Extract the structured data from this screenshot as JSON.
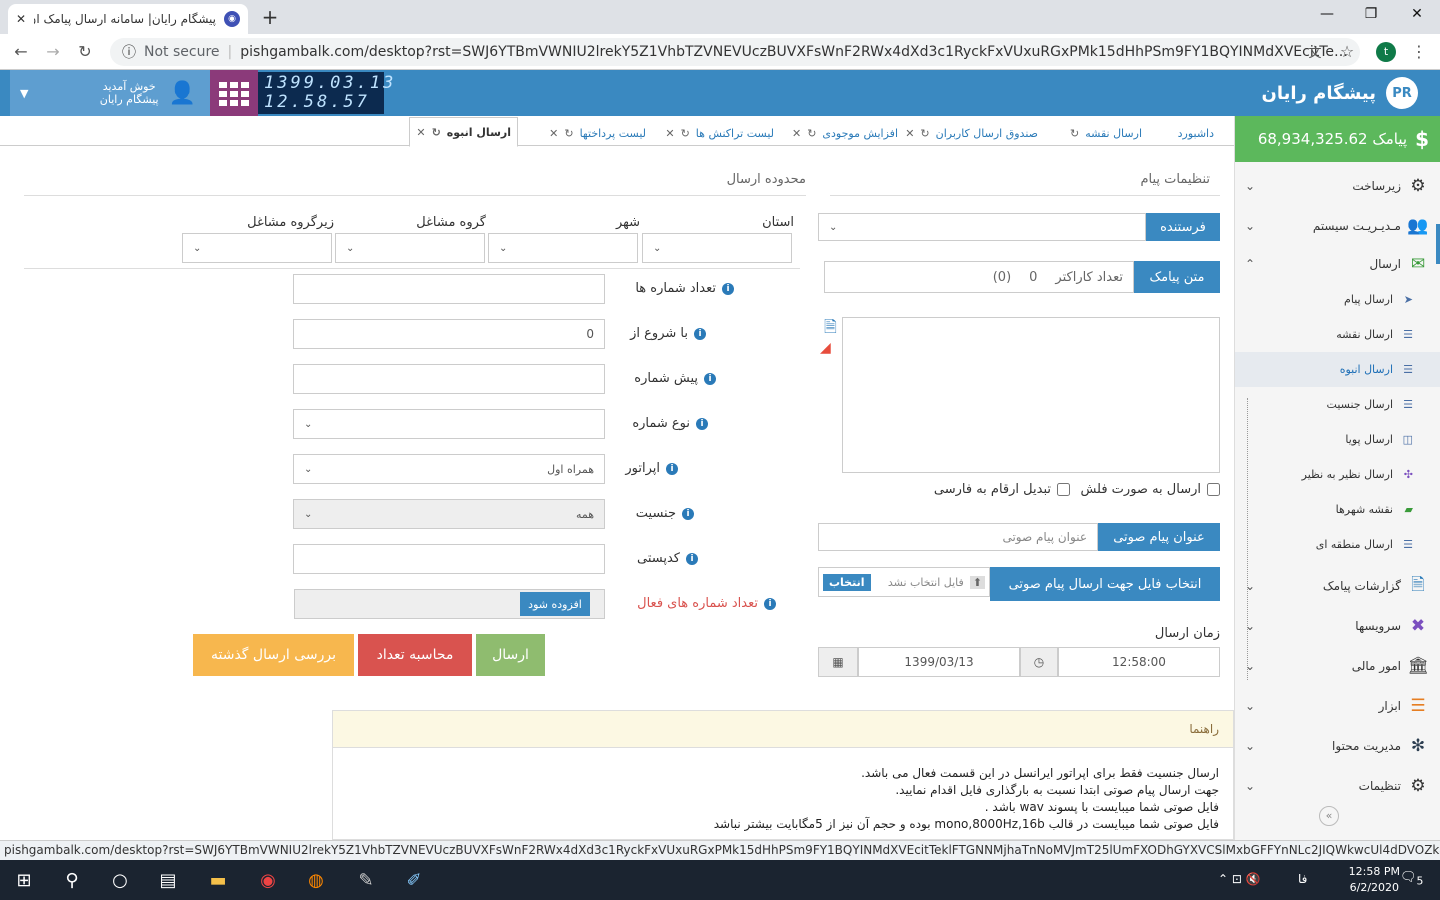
{
  "browser": {
    "tab_title": "پیشگام رایان| سامانه ارسال پیامک ان",
    "new_tab": "+",
    "security": "Not secure",
    "url": "pishgambalk.com/desktop?rst=SWJ6YTBmVWNIU2lrekY5Z1VhbTZVNEVUczBUVXFsWnF2RWx4dXd3c1RyckFxVUxuRGxPMk15dHhPSm9FY1BQYINMdXVEcitTeklFTGNNMjha...",
    "profile_initial": "t",
    "status_url": "pishgambalk.com/desktop?rst=SWJ6YTBmVWNIU2lrekY5Z1VhbTZVNEVUczBUVXFsWnF2RWx4dXd3c1RyckFxVUxuRGxPMk15dHhPSm9FY1BQYINMdXVEcitTeklFTGNNMjhaTnNoMVJmT25lUmFXODhGYXVCSlMxbGFFYnNLc2JIQWkwcUl4dDVOZk41OEhacnVlVDRXc..."
  },
  "header": {
    "brand": "پیشگام رایان",
    "logo": "PR",
    "date": "1399.03.13",
    "time": "12.58.57",
    "user_greeting": "خوش آمدید",
    "user_name": "پیشگام رایان"
  },
  "sidebar": {
    "credit": "68,934,325.62 پیامک",
    "credit_icon": "$",
    "items": [
      {
        "label": "زیرساخت",
        "icon": "gears-icon"
      },
      {
        "label": "مـدیـریـت سیستم",
        "icon": "users-icon"
      },
      {
        "label": "ارسال",
        "icon": "envelope-icon"
      },
      {
        "label": "گزارشات پیامک",
        "icon": "file-icon"
      },
      {
        "label": "سرویسها",
        "icon": "tools-icon"
      },
      {
        "label": "امور مالی",
        "icon": "bank-icon"
      },
      {
        "label": "ابزار",
        "icon": "bars-icon"
      },
      {
        "label": "مدیریت محتوا",
        "icon": "yelp-icon"
      },
      {
        "label": "تنظیمات",
        "icon": "gear-icon"
      }
    ],
    "subitems": [
      "ارسال پیام",
      "ارسال نقشه",
      "ارسال انبوه",
      "ارسال جنسیت",
      "ارسال پویا",
      "ارسال نظیر به نظیر",
      "نقشه شهرها",
      "ارسال منطقه ای"
    ]
  },
  "tabs": [
    "داشبورد",
    "ارسال نقشه",
    "صندوق ارسال کاربران",
    "افزایش موجودی",
    "لیست تراکنش ها",
    "لیست پرداختها",
    "ارسال انبوه"
  ],
  "settings": {
    "title": "تنظیمات پیام",
    "sender_label": "فرستنده",
    "sms_text_label": "متن پیامک",
    "char_count_label": "تعداد کاراکتر",
    "char_count": "0",
    "part_count": "(0)",
    "flash_label": "ارسال به صورت فلش",
    "persian_digits_label": "تبدیل ارقام به فارسی",
    "voice_title_label": "عنوان پیام صوتی",
    "voice_title_placeholder": "عنوان پیام صوتی",
    "voice_file_label": "انتخاب فایل جهت ارسال پیام صوتی",
    "file_placeholder": "فایل انتخاب نشد",
    "choose_label": "انتخاب",
    "send_time_label": "زمان ارسال",
    "send_time": "12:58:00",
    "send_date": "1399/03/13"
  },
  "scope": {
    "title": "محدوده ارسال",
    "province": "استان",
    "city": "شهر",
    "job_group": "گروه مشاغل",
    "job_subgroup": "زیرگروه مشاغل",
    "count_label": "تعداد شماره ها",
    "start_label": "با شروع از",
    "start_value": "0",
    "prefix_label": "پیش شماره",
    "number_type_label": "نوع شماره",
    "operator_label": "اپراتور",
    "operator_value": "همراه اول",
    "gender_label": "جنسیت",
    "gender_value": "همه",
    "postal_label": "کدپستی",
    "active_label": "تعداد شماره های فعال",
    "add_label": "افزوده شود"
  },
  "buttons": {
    "send": "ارسال",
    "calc": "محاسبه تعداد",
    "review": "بررسی ارسال گذشته"
  },
  "guide": {
    "title": "راهنما",
    "lines": [
      "ارسال جنسیت فقط برای اپراتور ایرانسل در این قسمت فعال می باشد.",
      "جهت ارسال پیام صوتی ابتدا نسبت به بارگذاری فایل اقدام نمایید.",
      "فایل صوتی شما میبایست با پسوند wav باشد .",
      "فایل صوتی شما میبایست در قالب mono,8000Hz,16b بوده و حجم آن نیز از 5مگابایت بیشتر نباشد"
    ]
  },
  "taskbar": {
    "lang": "فا",
    "time": "12:58 PM",
    "date": "6/2/2020",
    "notif": "5"
  },
  "colors": {
    "accent": "#3a89c1",
    "credit": "#5cb85c",
    "send": "#8fbc6f",
    "calc": "#d9534f",
    "review": "#f7b74e"
  }
}
